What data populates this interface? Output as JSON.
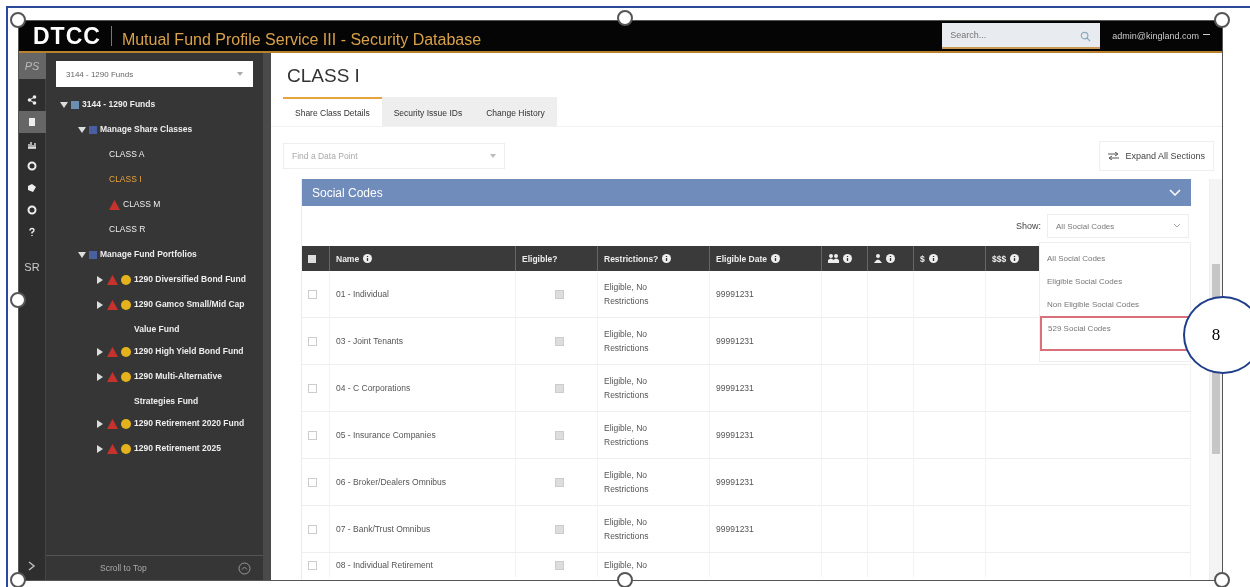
{
  "header": {
    "brand": "DTCC",
    "title": "Mutual Fund Profile Service III - Security Database",
    "search_placeholder": "Search...",
    "user": "admin@kingland.com"
  },
  "rail": {
    "top_label": "PS",
    "items": [
      {
        "kind": "share",
        "selected": false
      },
      {
        "kind": "document",
        "selected": true
      },
      {
        "kind": "chart",
        "selected": false
      },
      {
        "kind": "dot",
        "selected": false
      },
      {
        "kind": "tag",
        "selected": false
      },
      {
        "kind": "dot",
        "selected": false
      },
      {
        "kind": "help",
        "selected": false
      }
    ],
    "bottom_label": "SR"
  },
  "tree": {
    "fund_select": "3144 - 1290 Funds",
    "nodes": [
      {
        "label": "3144 - 1290 Funds",
        "kind": "folder",
        "expanded": true,
        "children": [
          {
            "label": "Manage Share Classes",
            "kind": "group",
            "expanded": true,
            "children": [
              {
                "label": "CLASS A",
                "kind": "leaf",
                "selected": false,
                "warning": false
              },
              {
                "label": "CLASS I",
                "kind": "leaf",
                "selected": true,
                "warning": false
              },
              {
                "label": "CLASS M",
                "kind": "leaf",
                "selected": false,
                "warning": true
              },
              {
                "label": "CLASS R",
                "kind": "leaf",
                "selected": false,
                "warning": false
              }
            ]
          },
          {
            "label": "Manage Fund Portfolios",
            "kind": "group",
            "expanded": true,
            "children": [
              {
                "label": "1290 Diversified Bond Fund",
                "kind": "fund",
                "expanded": false,
                "warning": true
              },
              {
                "label": "1290 Gamco Small/Mid Cap Value Fund",
                "kind": "fund",
                "expanded": false,
                "warning": true
              },
              {
                "label": "1290 High Yield Bond Fund",
                "kind": "fund",
                "expanded": false,
                "warning": true
              },
              {
                "label": "1290 Multi-Alternative Strategies Fund",
                "kind": "fund",
                "expanded": false,
                "warning": true
              },
              {
                "label": "1290 Retirement 2020 Fund",
                "kind": "fund",
                "expanded": false,
                "warning": true
              },
              {
                "label": "1290 Retirement 2025",
                "kind": "fund",
                "expanded": false,
                "warning": true
              }
            ]
          }
        ]
      }
    ],
    "scroll_to_top": "Scroll to Top"
  },
  "main": {
    "title": "CLASS I",
    "tabs": [
      {
        "label": "Share Class Details",
        "selected": true
      },
      {
        "label": "Security Issue IDs",
        "selected": false
      },
      {
        "label": "Change History",
        "selected": false
      }
    ],
    "find_placeholder": "Find a Data Point",
    "expand_button": "Expand All Sections",
    "section": {
      "title": "Social Codes",
      "show_label": "Show:",
      "show_value": "All Social Codes",
      "options": [
        {
          "label": "All Social Codes",
          "highlighted": false
        },
        {
          "label": "Eligible Social Codes",
          "highlighted": false
        },
        {
          "label": "Non Eligible Social Codes",
          "highlighted": false
        },
        {
          "label": "529 Social Codes",
          "highlighted": true
        }
      ],
      "columns": [
        {
          "kind": "select"
        },
        {
          "kind": "text",
          "label": "Name",
          "info": true
        },
        {
          "kind": "text",
          "label": "Eligible?",
          "info": false
        },
        {
          "kind": "text",
          "label": "Restrictions?",
          "info": true
        },
        {
          "kind": "text",
          "label": "Eligible Date",
          "info": true
        },
        {
          "kind": "people",
          "info": true
        },
        {
          "kind": "person",
          "info": true
        },
        {
          "kind": "text",
          "label": "$",
          "info": true
        },
        {
          "kind": "text",
          "label": "$$$",
          "info": true
        }
      ],
      "rows": [
        {
          "name": "01 - Individual",
          "selected": false,
          "eligible": true,
          "restrictions": "Eligible, No Restrictions",
          "date": "99991231"
        },
        {
          "name": "03 - Joint Tenants",
          "selected": false,
          "eligible": true,
          "restrictions": "Eligible, No Restrictions",
          "date": "99991231"
        },
        {
          "name": "04 - C Corporations",
          "selected": false,
          "eligible": true,
          "restrictions": "Eligible, No Restrictions",
          "date": "99991231"
        },
        {
          "name": "05 - Insurance Companies",
          "selected": false,
          "eligible": true,
          "restrictions": "Eligible, No Restrictions",
          "date": "99991231"
        },
        {
          "name": "06 - Broker/Dealers Omnibus",
          "selected": false,
          "eligible": true,
          "restrictions": "Eligible, No Restrictions",
          "date": "99991231"
        },
        {
          "name": "07 - Bank/Trust Omnibus",
          "selected": false,
          "eligible": true,
          "restrictions": "Eligible, No Restrictions",
          "date": "99991231"
        },
        {
          "name": "08 - Individual Retirement",
          "selected": false,
          "eligible": true,
          "restrictions": "Eligible, No"
        }
      ]
    }
  },
  "callout": "8"
}
